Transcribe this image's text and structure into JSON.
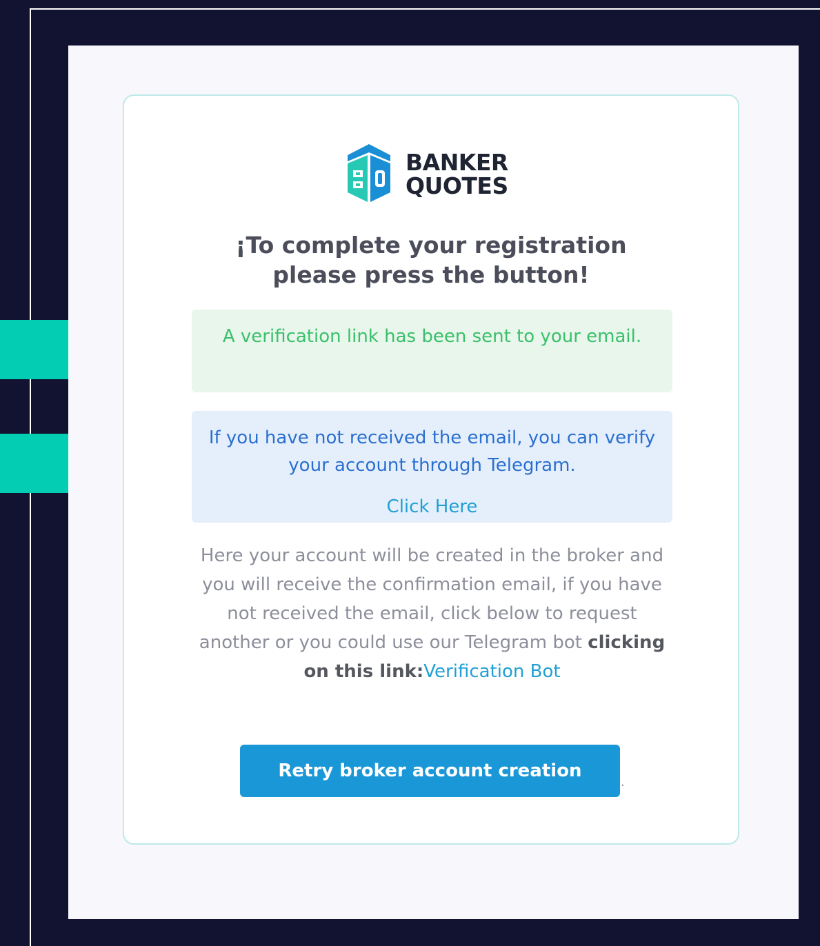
{
  "brand": {
    "line1": "BANKER",
    "line2": "QUOTES",
    "logo_icon": "banker-quotes-logo-icon",
    "colors": {
      "teal": "#27c9b4",
      "blue": "#1a8fd6"
    }
  },
  "card": {
    "heading_line1": "¡To complete your registration",
    "heading_line2": "please press the button!",
    "success_alert": "A verification link has been sent to your email.",
    "info_alert": {
      "text": "If you have not received the email, you can verify your account through Telegram.",
      "link": "Click Here"
    },
    "body": {
      "text": "Here your account will be created in the broker and you will receive the confirmation email, if you have not received the email, click below to request another or you could use our Telegram bot",
      "bold": "clicking on this link:",
      "link": "Verification Bot"
    },
    "retry_button": "Retry broker account creation",
    "trailing": "."
  },
  "colors": {
    "background": "#111330",
    "accent": "#03cdb2",
    "button": "#1a97d6",
    "success_bg": "#e8f6ec",
    "success_text": "#3bbf6a",
    "info_bg": "#e5effc",
    "info_text": "#2a6fcf"
  }
}
